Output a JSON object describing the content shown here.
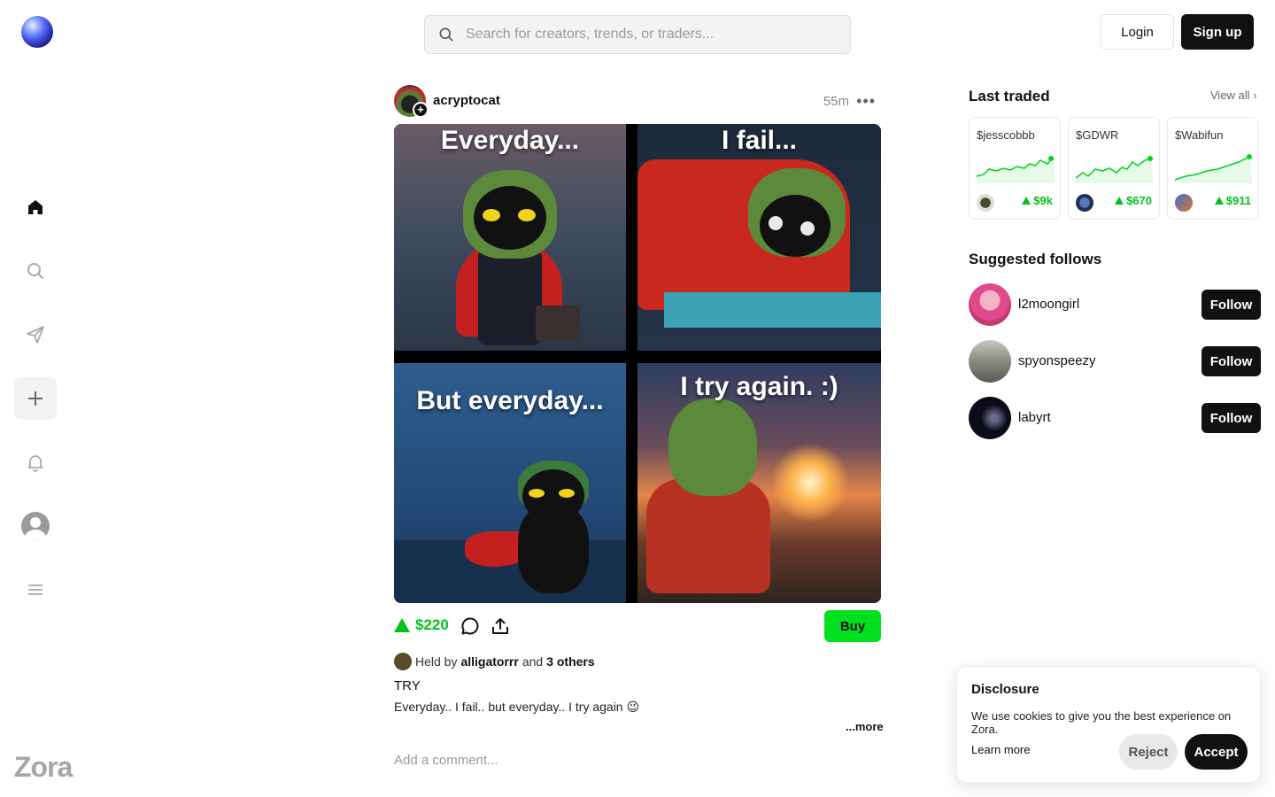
{
  "app": {
    "wordmark": "Zora"
  },
  "search": {
    "placeholder": "Search for creators, trends, or traders..."
  },
  "header": {
    "login_label": "Login",
    "signup_label": "Sign up"
  },
  "sidebar": {
    "items": [
      {
        "name": "home",
        "icon": "home-icon"
      },
      {
        "name": "search",
        "icon": "search-icon"
      },
      {
        "name": "messages",
        "icon": "send-icon"
      },
      {
        "name": "create",
        "icon": "plus-icon"
      },
      {
        "name": "notifications",
        "icon": "bell-icon"
      },
      {
        "name": "profile",
        "icon": "avatar"
      },
      {
        "name": "menu",
        "icon": "menu-icon"
      }
    ]
  },
  "post": {
    "creator": "acryptocat",
    "time": "55m",
    "panels": [
      "Everyday...",
      "I fail...",
      "But everyday...",
      "I try again. :)"
    ],
    "price": "$220",
    "buy_label": "Buy",
    "held_prefix": "Held by",
    "held_user": "alligatorrr",
    "held_and": "and",
    "held_others": "3 others",
    "title": "TRY",
    "body": "Everyday.. I fail.. but everyday.. I try again 😉",
    "more_label": "...more",
    "comment_placeholder": "Add a comment..."
  },
  "last_traded": {
    "title": "Last traded",
    "view_all": "View all",
    "items": [
      {
        "ticker": "$jesscobbb",
        "value": "$9k"
      },
      {
        "ticker": "$GDWR",
        "value": "$670"
      },
      {
        "ticker": "$Wabifun",
        "value": "$911"
      }
    ]
  },
  "suggested": {
    "title": "Suggested follows",
    "follow_label": "Follow",
    "users": [
      {
        "name": "l2moongirl"
      },
      {
        "name": "spyonspeezy"
      },
      {
        "name": "labyrt"
      }
    ]
  },
  "cookie": {
    "title": "Disclosure",
    "text": "We use cookies to give you the best experience on Zora.",
    "learn_more": "Learn more",
    "reject": "Reject",
    "accept": "Accept"
  },
  "colors": {
    "accent_green": "#00e01f",
    "price_green": "#00c21a",
    "dark": "#111111"
  }
}
